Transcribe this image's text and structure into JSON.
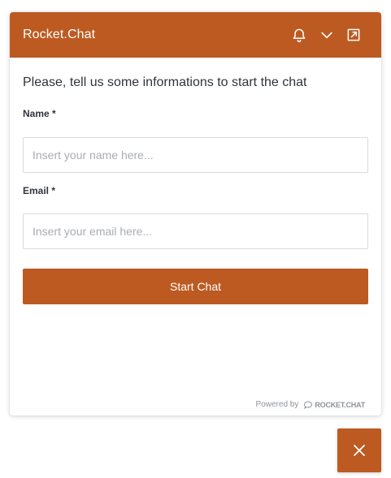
{
  "header": {
    "title": "Rocket.Chat",
    "icons": [
      "bell-icon",
      "chevron-down-icon",
      "popout-icon"
    ]
  },
  "form": {
    "intro": "Please, tell us some informations to start the chat",
    "name_label": "Name *",
    "name_placeholder": "Insert your name here...",
    "name_value": "",
    "email_label": "Email *",
    "email_placeholder": "Insert your email here...",
    "email_value": "",
    "submit_label": "Start Chat"
  },
  "footer": {
    "powered_by": "Powered by",
    "brand": "ROCKET.CHAT"
  },
  "colors": {
    "accent": "#bc5a22",
    "text": "#2f343d",
    "placeholder": "#a9acb1",
    "border": "#d9dbdf",
    "muted": "#8e9299"
  },
  "launcher": {
    "icon": "close-icon"
  }
}
